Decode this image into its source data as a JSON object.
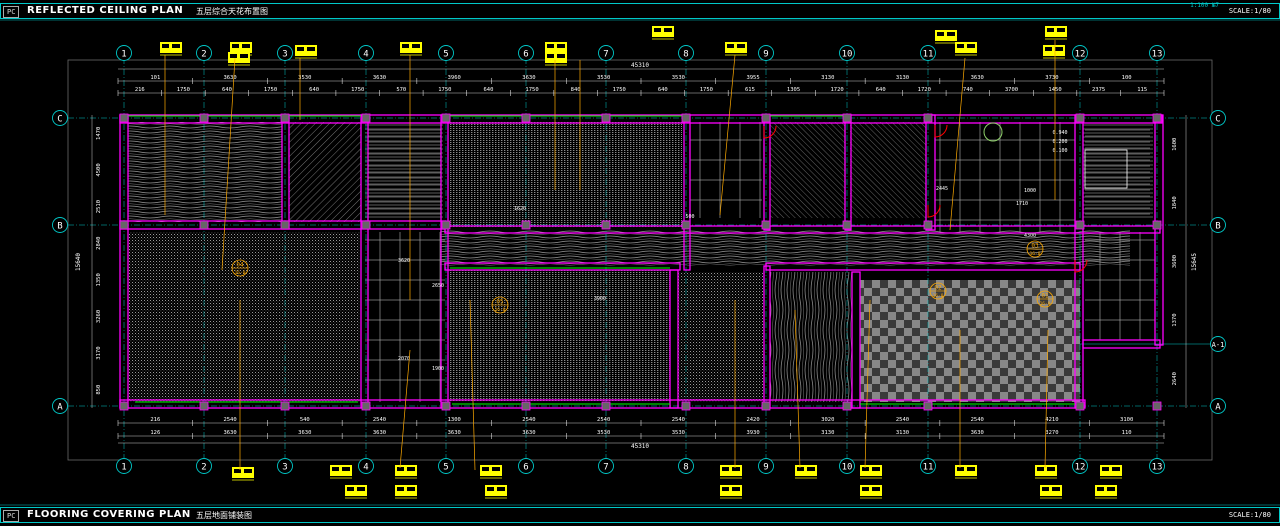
{
  "header": {
    "tag": "PC",
    "title": "REFLECTED CEILING PLAN",
    "subtitle": "五层综合天花布置图",
    "scale": "SCALE:1/80",
    "code": "1:100 №7"
  },
  "footer": {
    "tag": "PC",
    "title": "FLOORING COVERING PLAN",
    "subtitle": "五层地面铺装图",
    "scale": "SCALE:1/80"
  },
  "grid": {
    "columns": [
      "1",
      "2",
      "3",
      "4",
      "5",
      "6",
      "7",
      "8",
      "9",
      "10",
      "11",
      "12",
      "13"
    ],
    "rows": [
      "C",
      "B",
      "A"
    ],
    "extra_row": "A-1"
  },
  "dimensions": {
    "overall": "45310",
    "top_row1": [
      "101",
      "3630",
      "3530",
      "3630",
      "3960",
      "3630",
      "3530",
      "3530",
      "3955",
      "3130",
      "3130",
      "3630",
      "3730",
      "100"
    ],
    "top_row2": [
      "216",
      "1750",
      "640",
      "1750",
      "640",
      "1750",
      "570",
      "1750",
      "640",
      "1750",
      "840",
      "1750",
      "640",
      "1750",
      "615",
      "1305",
      "1720",
      "640",
      "1720",
      "740",
      "3700",
      "1450",
      "2375",
      "115"
    ],
    "bottom_row1": [
      "126",
      "3630",
      "3630",
      "3630",
      "3630",
      "3630",
      "3530",
      "3530",
      "3930",
      "3130",
      "3130",
      "3630",
      "3270",
      "110"
    ],
    "bottom_row2": [
      "216",
      "2540",
      "540",
      "2540",
      "1300",
      "2540",
      "2540",
      "2540",
      "2420",
      "3020",
      "2540",
      "2540",
      "4210",
      "3100"
    ],
    "left_side": [
      "1470",
      "4500",
      "2510",
      "2840",
      "1350",
      "3260",
      "3170",
      "850",
      "15640"
    ],
    "right_side": [
      "1600",
      "1840",
      "3600",
      "1370",
      "2640",
      "15645"
    ],
    "interior": [
      "3620",
      "2070",
      "2650",
      "1900",
      "3900",
      "500",
      "1620",
      "2445",
      "0.940",
      "0.200",
      "0.100",
      "1000",
      "1710",
      "4300"
    ]
  },
  "room_tags": [
    {
      "code": "04",
      "sub": "16-0"
    },
    {
      "code": "05",
      "sub": "16-0"
    },
    {
      "code": "02",
      "sub": "16-0"
    },
    {
      "code": "01",
      "sub": "16-0"
    },
    {
      "code": "03",
      "sub": "16-0"
    }
  ],
  "colors": {
    "background": "#000000",
    "wall": "#ff00ff",
    "grid_line": "#00c8c8",
    "dimension": "#ffffff",
    "hatch": "#bfbfbf",
    "leader": "#ffaa00",
    "callout_fill": "#ffff00",
    "callout_text": "#000000",
    "partition": "#00ff00",
    "door": "#ff0000"
  }
}
